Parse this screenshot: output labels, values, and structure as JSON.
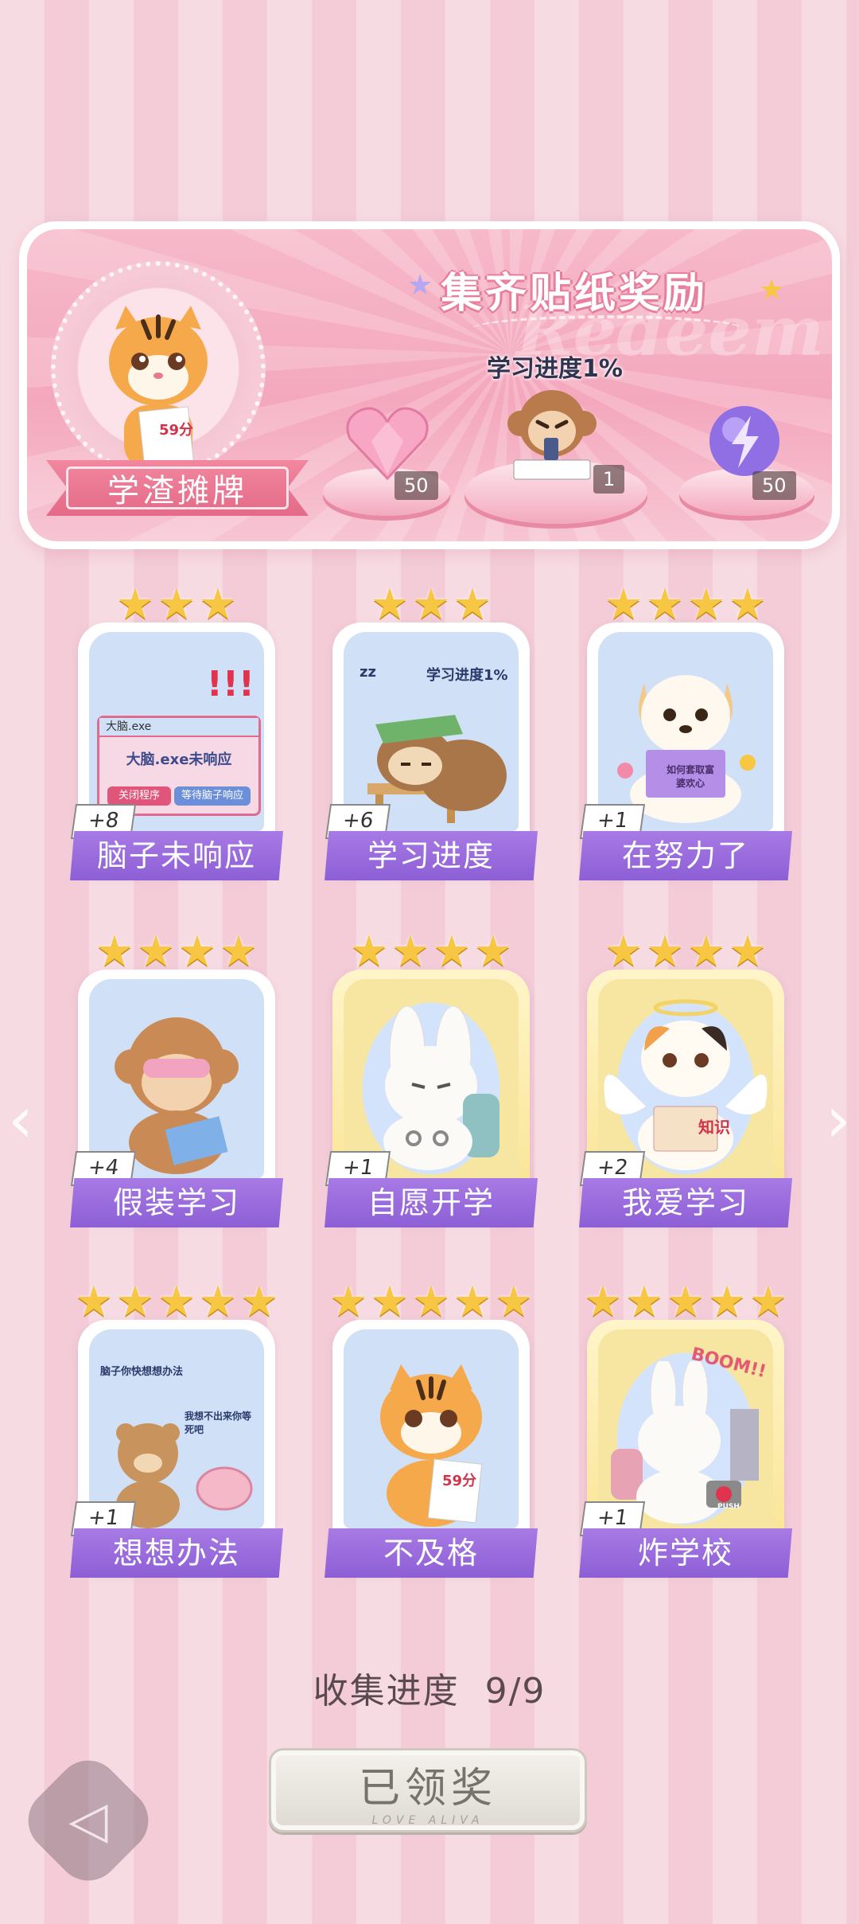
{
  "banner": {
    "title": "集齐贴纸奖励",
    "watermark": "Redeem",
    "avatar_label": "学渣摊牌",
    "avatar_paper": "59分",
    "progress_label": "学习进度1%",
    "rewards": [
      {
        "icon": "heart-gem-icon",
        "count": "50"
      },
      {
        "icon": "monkey-sticker-icon",
        "count": "1"
      },
      {
        "icon": "lightning-orb-icon",
        "count": "50"
      }
    ]
  },
  "stickers": [
    {
      "label": "脑子未响应",
      "plus": "+8",
      "stars": 3,
      "gold": false,
      "window_title": "大脑.exe",
      "window_msg": "大脑.exe未响应",
      "btn_close": "关闭程序",
      "btn_wait": "等待脑子响应",
      "marks": "!!!"
    },
    {
      "label": "学习进度",
      "plus": "+6",
      "stars": 3,
      "gold": false,
      "art_text": "学习进度1%",
      "zz": "zz"
    },
    {
      "label": "在努力了",
      "plus": "+1",
      "stars": 4,
      "gold": false,
      "book_text": "如何套取富婆欢心"
    },
    {
      "label": "假装学习",
      "plus": "+4",
      "stars": 4,
      "gold": false
    },
    {
      "label": "自愿开学",
      "plus": "+1",
      "stars": 4,
      "gold": true
    },
    {
      "label": "我爱学习",
      "plus": "+2",
      "stars": 4,
      "gold": true,
      "book_text": "知识"
    },
    {
      "label": "想想办法",
      "plus": "+1",
      "stars": 5,
      "gold": false,
      "bubble1": "脑子你快想想办法",
      "bubble2": "我想不出来你等死吧"
    },
    {
      "label": "不及格",
      "plus": "",
      "stars": 5,
      "gold": false,
      "paper": "59分"
    },
    {
      "label": "炸学校",
      "plus": "+1",
      "stars": 5,
      "gold": true,
      "boom": "BOOM!!",
      "push": "PUSH"
    }
  ],
  "collect": {
    "label": "收集进度",
    "value": "9/9"
  },
  "claim": {
    "label": "已领奖",
    "sub": "LOVE ALIVA"
  },
  "colors": {
    "accent_purple": "#8d5fd6",
    "banner_pink": "#f4a8bd",
    "star_gold": "#f7c744"
  }
}
